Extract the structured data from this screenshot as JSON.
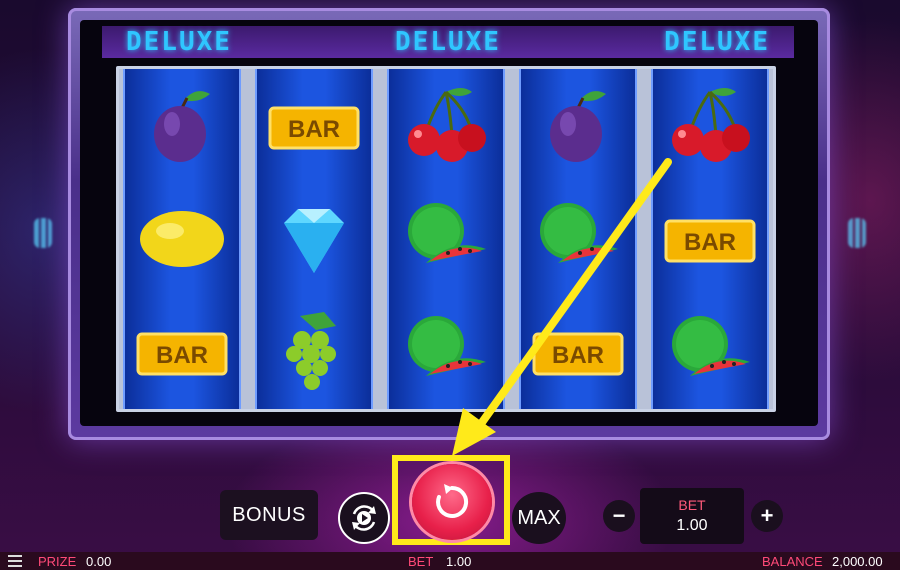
{
  "banner": {
    "labels": [
      "DELUXE",
      "DELUXE",
      "DELUXE"
    ]
  },
  "reels": [
    {
      "symbols": [
        "plum-icon",
        "lemon-icon",
        "bar-icon"
      ]
    },
    {
      "symbols": [
        "bar-icon",
        "diamond-icon",
        "grapes-icon"
      ]
    },
    {
      "symbols": [
        "cherries-icon",
        "watermelon-icon",
        "watermelon-icon"
      ]
    },
    {
      "symbols": [
        "plum-icon",
        "watermelon-icon",
        "bar-icon"
      ]
    },
    {
      "symbols": [
        "cherries-icon",
        "bar-icon",
        "watermelon-icon"
      ]
    }
  ],
  "symbol_text": {
    "bar": "BAR"
  },
  "controls": {
    "bonus_label": "BONUS",
    "max_label": "MAX",
    "minus_label": "−",
    "plus_label": "+",
    "bet_label": "BET",
    "bet_value": "1.00",
    "spin_icon": "refresh-icon",
    "autoplay_icon": "autoplay-icon"
  },
  "status": {
    "prize_label": "PRIZE",
    "prize_value": "0.00",
    "bet_label": "BET",
    "bet_value": "1.00",
    "balance_label": "BALANCE",
    "balance_value": "2,000.00"
  },
  "colors": {
    "accent_pink": "#ff4a78",
    "highlight_yellow": "#ffea1a",
    "spin_red": "#e8204a",
    "banner_cyan": "#2fc6ff"
  }
}
